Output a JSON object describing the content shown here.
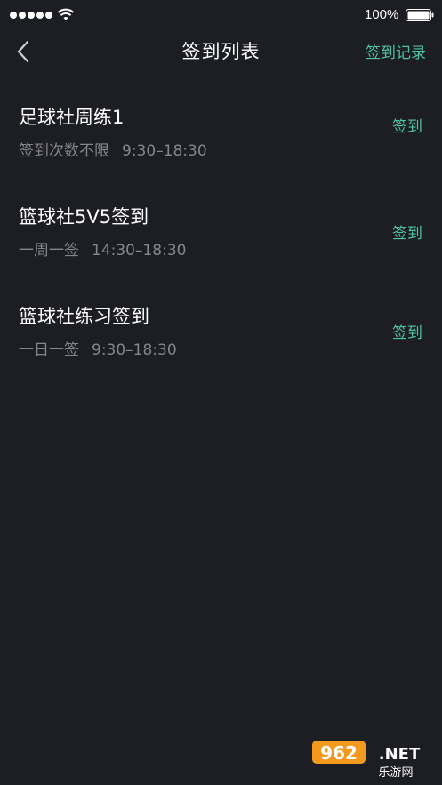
{
  "status": {
    "battery_percent": "100%"
  },
  "nav": {
    "title": "签到列表",
    "right_action": "签到记录"
  },
  "items": [
    {
      "title": "足球社周练1",
      "rule": "签到次数不限",
      "time": "9:30–18:30",
      "action": "签到"
    },
    {
      "title": "篮球社5V5签到",
      "rule": "一周一签",
      "time": "14:30–18:30",
      "action": "签到"
    },
    {
      "title": "篮球社练习签到",
      "rule": "一日一签",
      "time": "9:30–18:30",
      "action": "签到"
    }
  ],
  "watermark": {
    "brand": "962.NET",
    "caption": "乐游网"
  },
  "colors": {
    "background": "#1d1e23",
    "accent": "#4fc3a1",
    "secondary_text": "#85868c"
  }
}
